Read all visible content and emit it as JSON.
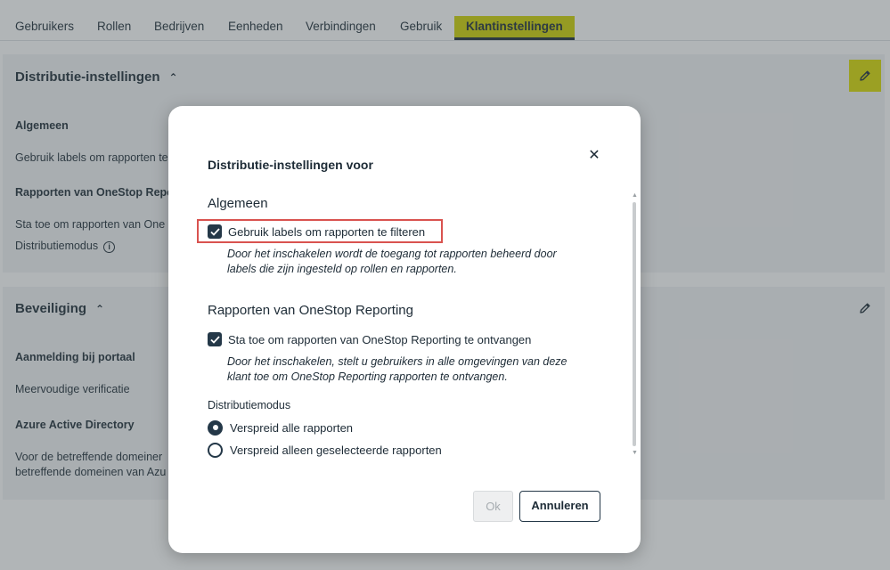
{
  "tabs": [
    {
      "label": "Gebruikers",
      "active": false
    },
    {
      "label": "Rollen",
      "active": false
    },
    {
      "label": "Bedrijven",
      "active": false
    },
    {
      "label": "Eenheden",
      "active": false
    },
    {
      "label": "Verbindingen",
      "active": false
    },
    {
      "label": "Gebruik",
      "active": false
    },
    {
      "label": "Klantinstellingen",
      "active": true
    }
  ],
  "distribution_section": {
    "title": "Distributie-instellingen",
    "general_heading": "Algemeen",
    "general_text": "Gebruik labels om rapporten te",
    "reports_heading": "Rapporten van OneStop Reporti",
    "reports_text": "Sta toe om rapporten van One",
    "mode_label": "Distributiemodus"
  },
  "security_section": {
    "title": "Beveiliging",
    "portal_heading": "Aanmelding bij portaal",
    "portal_text": "Meervoudige verificatie",
    "aad_heading": "Azure Active Directory",
    "aad_text_line1": "Voor de betreffende domeiner",
    "aad_text_line2": "betreffende domeinen van Azu"
  },
  "dialog": {
    "title": "Distributie-instellingen voor",
    "general_heading": "Algemeen",
    "use_labels": {
      "label": "Gebruik labels om rapporten te filteren",
      "checked": true,
      "description_line1": "Door het inschakelen wordt de toegang tot rapporten beheerd door",
      "description_line2": "labels die zijn ingesteld op rollen en rapporten."
    },
    "reports_heading": "Rapporten van OneStop Reporting",
    "allow_reports": {
      "label": "Sta toe om rapporten van OneStop Reporting te ontvangen",
      "checked": true,
      "description_line1": "Door het inschakelen, stelt u gebruikers in alle omgevingen van deze",
      "description_line2": "klant toe om OneStop Reporting rapporten te ontvangen."
    },
    "mode_label": "Distributiemodus",
    "mode_options": [
      {
        "label": "Verspreid alle rapporten",
        "selected": true
      },
      {
        "label": "Verspreid alleen geselecteerde rapporten",
        "selected": false
      }
    ],
    "ok_label": "Ok",
    "cancel_label": "Annuleren"
  },
  "colors": {
    "accent": "#cfd300",
    "primary": "#243848",
    "highlight_border": "#d9534f"
  }
}
